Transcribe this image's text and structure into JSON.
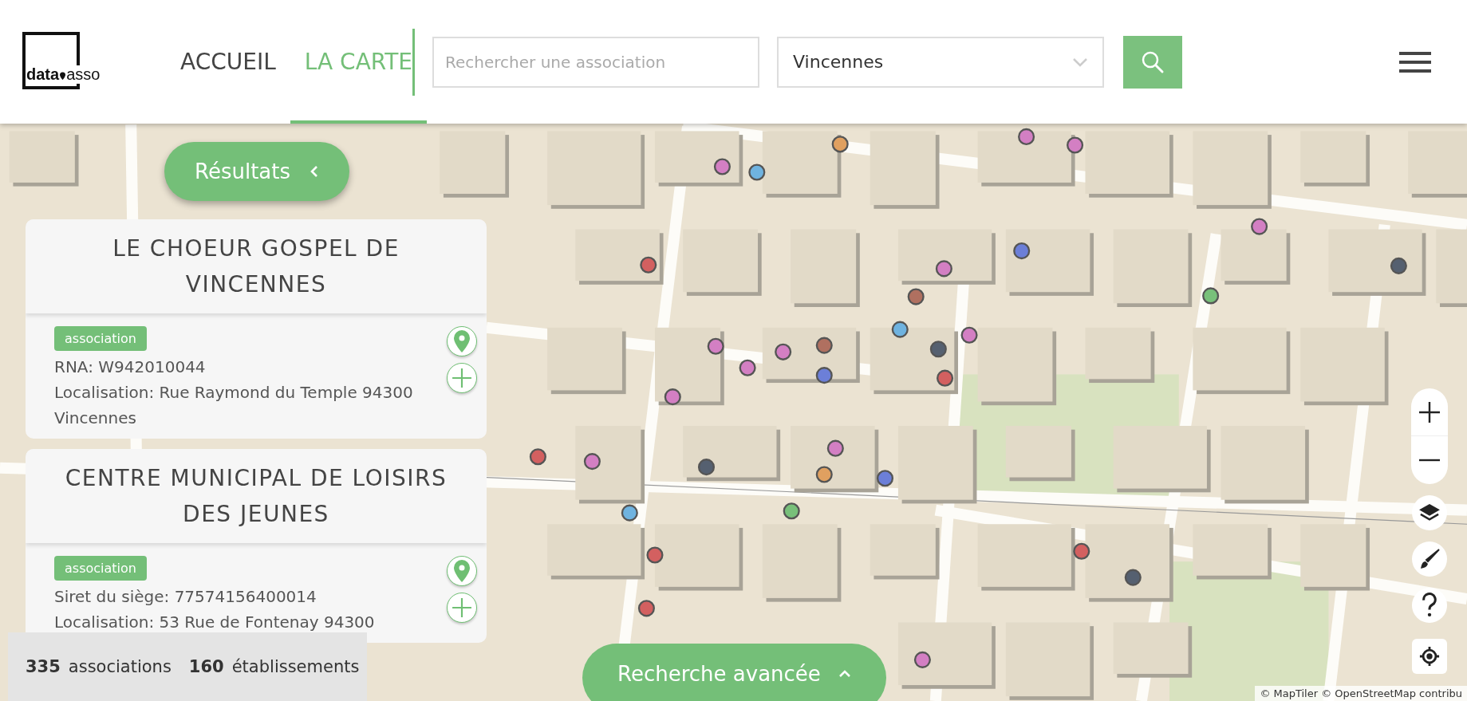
{
  "header": {
    "logo": {
      "word_1": "data",
      "word_2": "asso"
    },
    "nav": [
      {
        "label": "ACCUEIL",
        "selected": false
      },
      {
        "label": "LA CARTE",
        "selected": true
      }
    ],
    "search": {
      "placeholder": "Rechercher une association"
    },
    "city_select": {
      "value": "Vincennes"
    }
  },
  "results_button": {
    "label": "Résultats"
  },
  "results": [
    {
      "title": "LE CHOEUR GOSPEL DE VINCENNES",
      "tag": "association",
      "lines": [
        "RNA: W942010044",
        "Localisation: Rue Raymond du Temple 94300 Vincennes"
      ]
    },
    {
      "title": "CENTRE MUNICIPAL DE LOISIRS DES JEUNES",
      "tag": "association",
      "lines": [
        "Siret du siège: 77574156400014",
        "Localisation: 53 Rue de Fontenay 94300"
      ]
    }
  ],
  "stats": [
    {
      "count": "335",
      "label": "associations"
    },
    {
      "count": "160",
      "label": "établissements"
    }
  ],
  "advanced_search": {
    "label": "Recherche avancée"
  },
  "attribution": "© MapTiler © OpenStreetMap contribu"
}
